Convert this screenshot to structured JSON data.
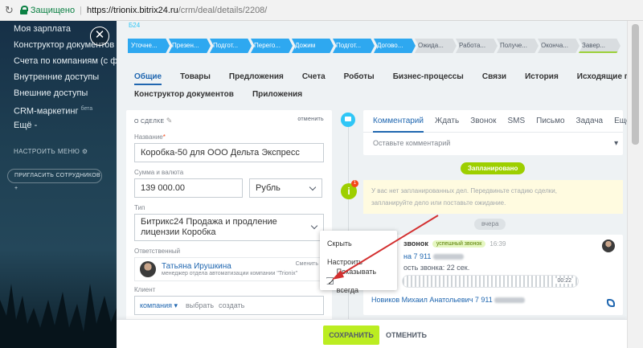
{
  "browser": {
    "secure_label": "Защищено",
    "url_host": "https://trionix.bitrix24.ru",
    "url_path": "/crm/deal/details/2208/"
  },
  "leftnav": {
    "items": [
      "Моя зарплата",
      "Конструктор документов",
      "Счета по компаниям (с ф...",
      "Внутренние доступы",
      "Внешние доступы",
      "CRM-маркетинг",
      "Ещё"
    ],
    "crm_sup": "бета",
    "more_suffix": "-",
    "configure_menu": "НАСТРОИТЬ МЕНЮ",
    "invite": "ПРИГЛАСИТЬ СОТРУДНИКОВ"
  },
  "header": {
    "b24": "Б24"
  },
  "stages": [
    {
      "label": "Уточне...",
      "state": "active"
    },
    {
      "label": "Презен...",
      "state": "active"
    },
    {
      "label": "Подгот...",
      "state": "active"
    },
    {
      "label": "Перего...",
      "state": "active"
    },
    {
      "label": "Дожим",
      "state": "active"
    },
    {
      "label": "Подгот...",
      "state": "active"
    },
    {
      "label": "Догово...",
      "state": "active"
    },
    {
      "label": "Ожида...",
      "state": "inactive"
    },
    {
      "label": "Работа...",
      "state": "inactive"
    },
    {
      "label": "Получе...",
      "state": "inactive"
    },
    {
      "label": "Оконча...",
      "state": "inactive"
    },
    {
      "label": "Завер...",
      "state": "inactive"
    }
  ],
  "tabs_row1": [
    "Общие",
    "Товары",
    "Предложения",
    "Счета",
    "Роботы",
    "Бизнес-процессы",
    "Связи",
    "История",
    "Исходящие письма"
  ],
  "tabs_row2": [
    "Конструктор документов",
    "Приложения"
  ],
  "deal": {
    "section": "О СДЕЛКЕ",
    "cancel": "отменить",
    "name_label": "Название",
    "name_req": "*",
    "name_value": "Коробка-50 для ООО Дельта Экспресс",
    "sum_label": "Сумма и валюта",
    "sum_value": "139 000.00",
    "currency": "Рубль",
    "type_label": "Тип",
    "type_value": "Битрикс24 Продажа и продление лицензии Коробка",
    "resp_label": "Ответственный",
    "resp_name": "Татьяна Ирушкина",
    "resp_position": "менеджер отдела автоматизации компании \"Trionix\"",
    "resp_change": "Сменить",
    "client_label": "Клиент",
    "client_type": "компания",
    "client_select": "выбрать",
    "client_create": "создать"
  },
  "activity": {
    "tabs": [
      "Комментарий",
      "Ждать",
      "Звонок",
      "SMS",
      "Письмо",
      "Задача"
    ],
    "more": "Ещё",
    "placeholder": "Оставьте комментарий",
    "planned": "Запланировано",
    "planned_note_1": "У вас нет запланированных дел. Передвиньте стадию сделки,",
    "planned_note_2": "запланируйте дело или поставьте ожидание.",
    "badge_count": "1",
    "yesterday": "вчера"
  },
  "call": {
    "title": "звонок",
    "badge": "успешный звонок",
    "time": "16:39",
    "phone": "на 7 911",
    "duration": "ость звонка: 22 сек.",
    "player_time": "00:22",
    "person": "Новиков Михаил Анатольевич 7 911"
  },
  "context_menu": {
    "hide": "Скрыть",
    "configure": "Настроить",
    "show_always": "Показывать всегда"
  },
  "footer": {
    "save": "СОХРАНИТЬ",
    "cancel": "ОТМЕНИТЬ"
  },
  "colors": {
    "stage_active": "#2ea8f0",
    "stage_inactive": "#d9dde0",
    "save_button": "#bbed21",
    "link": "#2067b0",
    "annotation_arrow": "#d32f2f"
  }
}
